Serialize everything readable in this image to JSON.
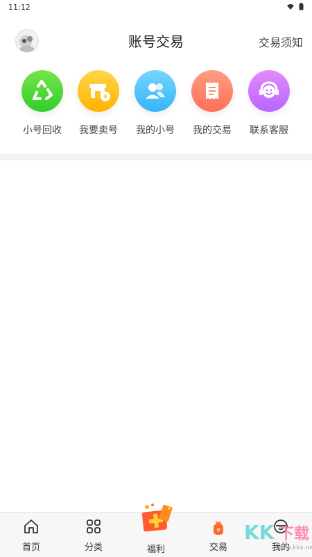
{
  "status": {
    "time": "11:12"
  },
  "header": {
    "title": "账号交易",
    "notice": "交易须知"
  },
  "shortcuts": [
    {
      "label": "小号回收",
      "icon": "recycle-icon",
      "color": "#3fd23a"
    },
    {
      "label": "我要卖号",
      "icon": "shop-icon",
      "color": "#ffc21a"
    },
    {
      "label": "我的小号",
      "icon": "users-icon",
      "color": "#4fc3ff"
    },
    {
      "label": "我的交易",
      "icon": "receipt-icon",
      "color": "#ff8a6e"
    },
    {
      "label": "联系客服",
      "icon": "headset-icon",
      "color": "#d27dff"
    }
  ],
  "tabs": [
    {
      "label": "首页",
      "icon": "home-icon"
    },
    {
      "label": "分类",
      "icon": "grid-icon"
    },
    {
      "label": "福利",
      "icon": "gift-icon"
    },
    {
      "label": "交易",
      "icon": "money-bag-icon"
    },
    {
      "label": "我的",
      "icon": "profile-icon"
    }
  ],
  "watermark": {
    "brand": "KK下载",
    "url": "www.kkx.net"
  }
}
